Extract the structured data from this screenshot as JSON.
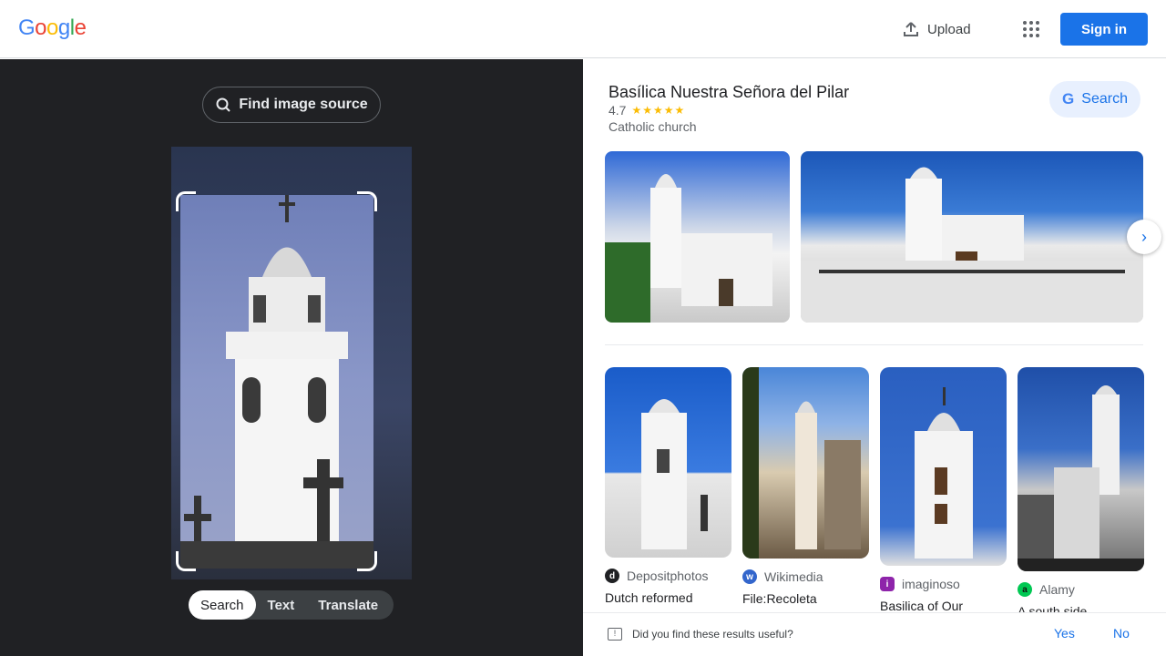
{
  "header": {
    "logo": [
      {
        "ch": "G",
        "color": "#4285F4"
      },
      {
        "ch": "o",
        "color": "#EA4335"
      },
      {
        "ch": "o",
        "color": "#FBBC05"
      },
      {
        "ch": "g",
        "color": "#4285F4"
      },
      {
        "ch": "l",
        "color": "#34A853"
      },
      {
        "ch": "e",
        "color": "#EA4335"
      }
    ],
    "upload_label": "Upload",
    "apps_icon": "apps-grid-icon",
    "signin_label": "Sign in"
  },
  "left": {
    "find_source_label": "Find image source",
    "tabs": [
      "Search",
      "Text",
      "Translate"
    ],
    "active_tab": "Search"
  },
  "knowledge_panel": {
    "title": "Basílica Nuestra Señora del Pilar",
    "rating": "4.7",
    "stars": "★★★★★",
    "subtitle": "Catholic church",
    "search_label": "Search"
  },
  "results": [
    {
      "source": "Depositphotos",
      "icon_letter": "d",
      "icon_color": "#202124",
      "title": "Dutch reformed"
    },
    {
      "source": "Wikimedia",
      "icon_letter": "w",
      "icon_color": "#3366cc",
      "title": "File:Recoleta"
    },
    {
      "source": "imaginoso",
      "icon_letter": "i",
      "icon_color": "#8e24aa",
      "title": "Basilica of Our"
    },
    {
      "source": "Alamy",
      "icon_letter": "a",
      "icon_color": "#00c853",
      "title": "A south side"
    }
  ],
  "feedback": {
    "question": "Did you find these results useful?",
    "yes": "Yes",
    "no": "No"
  },
  "colors": {
    "accent": "#1a73e8",
    "dark_bg": "#202124"
  }
}
